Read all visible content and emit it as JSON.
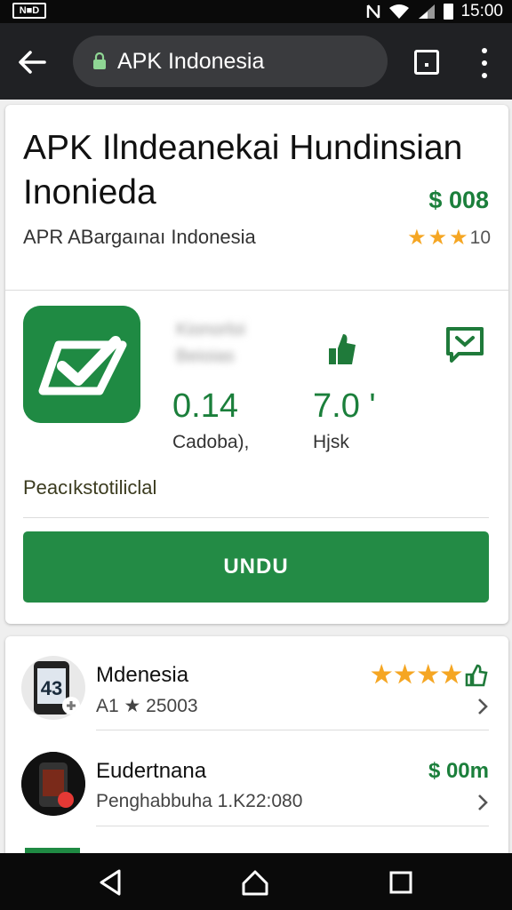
{
  "status_bar": {
    "left_badge": "N■D",
    "time": "15:00"
  },
  "browser": {
    "url": "APK Indonesia"
  },
  "app": {
    "title": "APK Ilndeanekai Hundinsian Inonieda",
    "price": "$ 008",
    "developer": "APR ABargaınaı Indonesia",
    "rating_value": "10",
    "rating_stars": 3,
    "blurred_label": "Kionorloi Beioias",
    "stat1_value": "0.14",
    "stat1_label": "Cadoba),",
    "stat2_value": "7.0 '",
    "stat2_label": "Hjsk",
    "category": "Peacıkstotiliclal",
    "install_label": "UNDU"
  },
  "list": [
    {
      "title": "Mdenesia",
      "subtitle": "A1 ★ 25003",
      "stars": 4,
      "avatar_text": "43",
      "right": ""
    },
    {
      "title": "Eudertnana",
      "subtitle": "Penghabbuha 1.K22:080",
      "stars": 0,
      "avatar_text": "",
      "right": "$ 00m"
    }
  ],
  "colors": {
    "accent": "#238b45",
    "accent_text": "#1b7f3b",
    "star": "#f5a623",
    "toolbar": "#202124"
  }
}
